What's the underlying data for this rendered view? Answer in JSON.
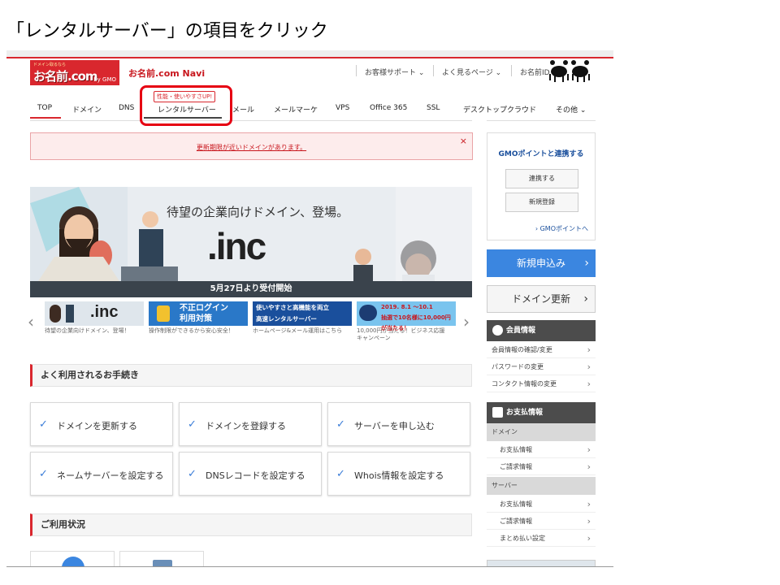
{
  "slide": {
    "title": "「レンタルサーバー」の項目をクリック"
  },
  "header": {
    "logo_small": "ドメイン取るなら",
    "logo_main": "お名前.com",
    "logo_gmo": "by GMO",
    "navi_title": "お名前.com Navi",
    "util": [
      "お客様サポート ⌄",
      "よく見るページ ⌄",
      "お名前ID ⌄"
    ]
  },
  "nav": {
    "items": [
      "TOP",
      "ドメイン",
      "DNS",
      "レンタルサーバー",
      "メール",
      "メールマーケ",
      "VPS",
      "Office 365",
      "SSL",
      "デスクトップクラウド",
      "その他 ⌄"
    ],
    "badge": "性能・使いやすさUP!"
  },
  "alert": {
    "text": "更新期限が近いドメインがあります。",
    "close": "×"
  },
  "banner": {
    "copy": "待望の企業向けドメイン、登場。",
    "inc": ".inc",
    "footer": "5月27日より受付開始"
  },
  "thumbs": [
    {
      "label": ".inc",
      "caption": "待望の企業向けドメイン、登場！"
    },
    {
      "label": "不正ログイン\n利用対策",
      "caption": "操作制限ができるから安心安全！"
    },
    {
      "label": "使いやすさと高機能を両立\n高速レンタルサーバー",
      "caption": "ホームページ&メール運用はこちら"
    },
    {
      "label": "2019. 8.1 〜10.1\n抽選で10名様に10,000円が当たる！",
      "caption": "10,000円が当たる！ビジネス応援\nキャンペーン"
    }
  ],
  "sections": {
    "procedures_title": "よく利用されるお手続き",
    "usage_title": "ご利用状況"
  },
  "procedures": [
    "ドメインを更新する",
    "ドメインを登録する",
    "サーバーを申し込む",
    "ネームサーバーを設定する",
    "DNSレコードを設定する",
    "Whois情報を設定する"
  ],
  "sidebar": {
    "gmo_title": "GMOポイントと連携する",
    "gmo_link_button": "連携する",
    "gmo_register_button": "新規登録",
    "gmo_point_link": "› GMOポイントへ",
    "apply_button": "新規申込み",
    "renew_button": "ドメイン更新",
    "member_title": "会員情報",
    "member_items": [
      "会員情報の確認/変更",
      "パスワードの変更",
      "コンタクト情報の変更"
    ],
    "payment_title": "お支払情報",
    "payment_domain_label": "ドメイン",
    "payment_domain_items": [
      "お支払情報",
      "ご請求情報"
    ],
    "payment_server_label": "サーバー",
    "payment_server_items": [
      "お支払情報",
      "ご請求情報",
      "まとめ払い設定"
    ]
  },
  "colors": {
    "brand_red": "#d9272e",
    "accent_blue": "#3b86e0",
    "highlight_red": "#e60012"
  }
}
